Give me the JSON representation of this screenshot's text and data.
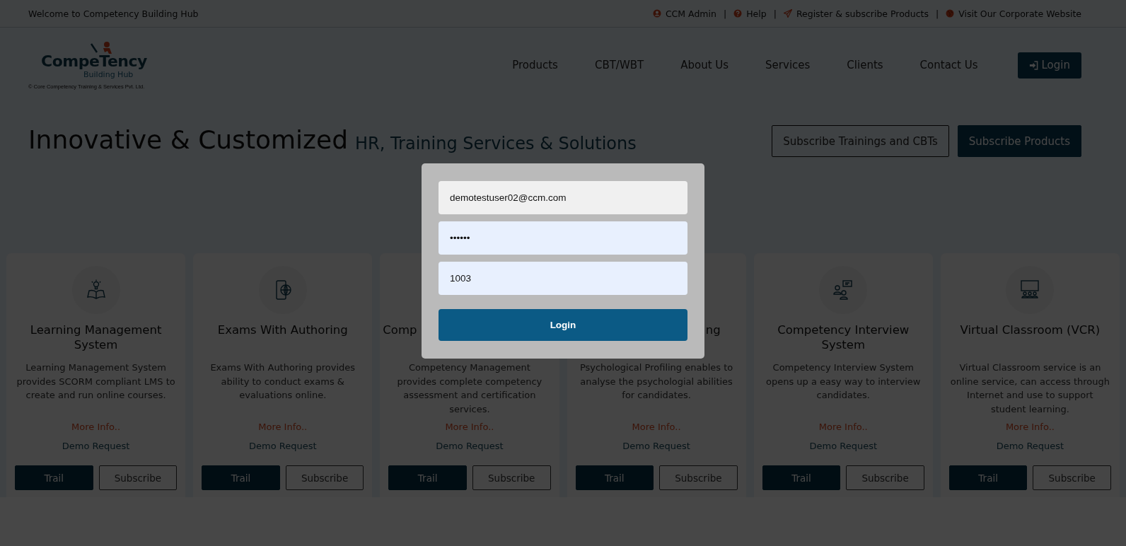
{
  "top_bar": {
    "welcome": "Welcome to Competency Building Hub",
    "links": [
      {
        "kind": "user",
        "label": "CCM Admin"
      },
      {
        "kind": "help",
        "label": "Help"
      },
      {
        "kind": "send",
        "label": "Register & subscribe Products"
      },
      {
        "kind": "globe",
        "label": "Visit Our Corporate Website"
      }
    ],
    "separator": "|"
  },
  "logo": {
    "name": "CompeTency",
    "sub": "Building Hub",
    "copyright": "© Core Competency Training & Services Pvt. Ltd."
  },
  "nav": {
    "items": [
      "Products",
      "CBT/WBT",
      "About Us",
      "Services",
      "Clients",
      "Contact Us"
    ],
    "login": "Login"
  },
  "hero": {
    "title": "Innovative & Customized",
    "subtitle": "HR, Training Services & Solutions",
    "buttons": [
      {
        "kind": "outline",
        "label": "Subscribe Trainings and CBTs"
      },
      {
        "kind": "filled",
        "label": "Subscribe Products"
      }
    ]
  },
  "products": [
    {
      "kind": "lamp-book",
      "title": "Learning Management System",
      "description": "Learning Management System provides SCORM compliant LMS to create and run online courses.",
      "more_info": "More Info..",
      "demo": "Demo Request",
      "trail": "Trail",
      "subscribe": "Subscribe"
    },
    {
      "kind": "phone-globe",
      "title": "Exams With Authoring",
      "description": "Exams With Authoring provides ability to conduct exams & evaluations online.",
      "more_info": "More Info..",
      "demo": "Demo Request",
      "trail": "Trail",
      "subscribe": "Subscribe"
    },
    {
      "title": "Comp",
      "description": "Competency Management provides complete competency assessment and certification services.",
      "more_info": "More Info..",
      "demo": "Demo Request",
      "trail": "Trail",
      "subscribe": "Subscribe"
    },
    {
      "title": "ng",
      "description": "Psychological Profiling enables to analyse the psychologial abilities for candidates.",
      "more_info": "More Info..",
      "demo": "Demo Request",
      "trail": "Trail",
      "subscribe": "Subscribe"
    },
    {
      "kind": "interview",
      "title": "Competency Interview System",
      "description": "Competency Interview System opens up a easy way to interview candidates.",
      "more_info": "More Info..",
      "demo": "Demo Request",
      "trail": "Trail",
      "subscribe": "Subscribe"
    },
    {
      "kind": "classroom",
      "title": "Virtual Classroom (VCR)",
      "description": "Virtual Classroom service is an online service, can access through Internet and use to support student learning.",
      "more_info": "More Info..",
      "demo": "Demo Request",
      "trail": "Trail",
      "subscribe": "Subscribe"
    }
  ],
  "login_dialog": {
    "fields": [
      {
        "kind": "email",
        "value": "demotestuser02@ccm.com"
      },
      {
        "kind": "password",
        "value": "••••••"
      },
      {
        "kind": "code",
        "value": "1003"
      }
    ],
    "button": "Login"
  }
}
